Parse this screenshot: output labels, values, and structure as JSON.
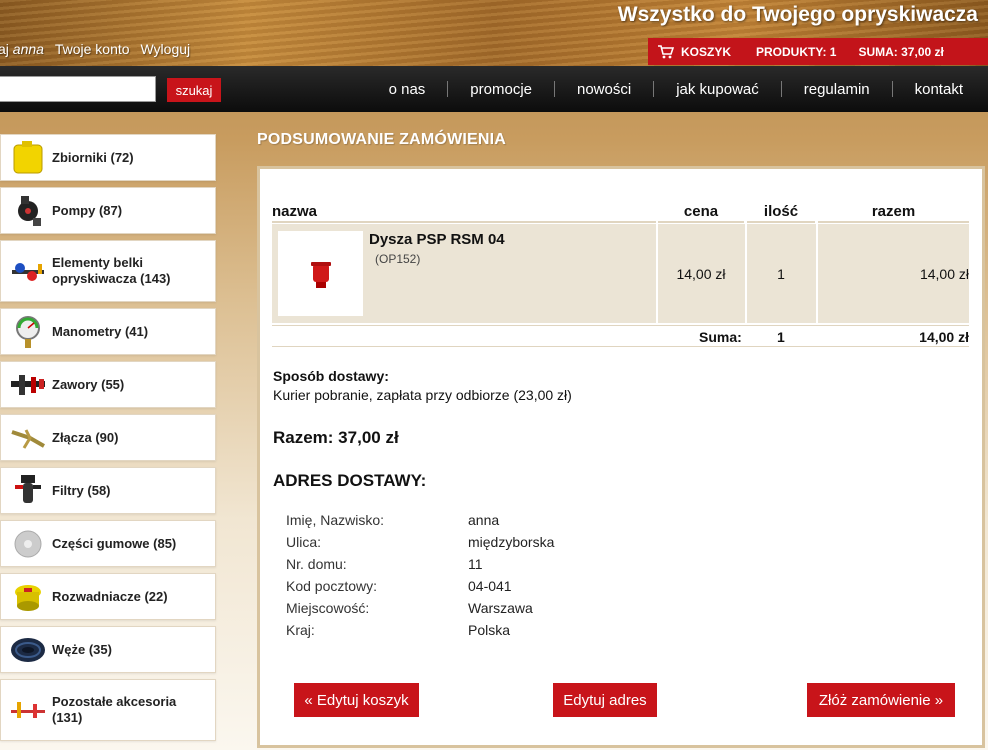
{
  "header": {
    "tagline": "Wszystko do Twojego opryskiwacza",
    "greeting": "aj",
    "username": "anna",
    "account_link": "Twoje konto",
    "logout_link": "Wyloguj",
    "cart": {
      "label": "KOSZYK",
      "products": "PRODUKTY: 1",
      "sum": "SUMA: 37,00 zł"
    }
  },
  "nav": {
    "search_placeholder": "",
    "search_button": "szukaj",
    "links": [
      "o nas",
      "promocje",
      "nowości",
      "jak kupować",
      "regulamin",
      "kontakt"
    ]
  },
  "sidebar": {
    "items": [
      {
        "label": "Zbiorniki (72)",
        "icon": "tank-icon"
      },
      {
        "label": "Pompy (87)",
        "icon": "pump-icon"
      },
      {
        "label": "Elementy belki opryskiwacza (143)",
        "icon": "boom-icon"
      },
      {
        "label": "Manometry (41)",
        "icon": "gauge-icon"
      },
      {
        "label": "Zawory (55)",
        "icon": "valve-icon"
      },
      {
        "label": "Złącza (90)",
        "icon": "connector-icon"
      },
      {
        "label": "Filtry (58)",
        "icon": "filter-icon"
      },
      {
        "label": "Części gumowe (85)",
        "icon": "rubber-icon"
      },
      {
        "label": "Rozwadniacze (22)",
        "icon": "agitator-icon"
      },
      {
        "label": "Węże (35)",
        "icon": "hose-icon"
      },
      {
        "label": "Pozostałe akcesoria (131)",
        "icon": "accessory-icon"
      }
    ]
  },
  "main": {
    "title": "PODSUMOWANIE ZAMÓWIENIA",
    "table": {
      "headers": {
        "name": "nazwa",
        "price": "cena",
        "qty": "ilość",
        "total": "razem"
      },
      "items": [
        {
          "name": "Dysza PSP RSM 04",
          "code": "(OP152)",
          "price": "14,00 zł",
          "qty": "1",
          "total": "14,00 zł"
        }
      ],
      "sum_label": "Suma:",
      "sum_qty": "1",
      "sum_total": "14,00 zł"
    },
    "shipping": {
      "title": "Sposób dostawy:",
      "value": "Kurier pobranie, zapłata przy odbiorze (23,00 zł)"
    },
    "razem": "Razem: 37,00 zł",
    "address": {
      "title": "ADRES DOSTAWY:",
      "rows": [
        {
          "k": "Imię, Nazwisko:",
          "v": "anna"
        },
        {
          "k": "Ulica:",
          "v": "międzyborska"
        },
        {
          "k": "Nr. domu:",
          "v": "11"
        },
        {
          "k": "Kod pocztowy:",
          "v": "04-041"
        },
        {
          "k": "Miejscowość:",
          "v": "Warszawa"
        },
        {
          "k": "Kraj:",
          "v": "Polska"
        }
      ]
    },
    "buttons": {
      "edit_cart": "« Edytuj koszyk",
      "edit_address": "Edytuj adres",
      "place_order": "Złóż zamówienie »"
    }
  },
  "colors": {
    "accent": "#c8141a",
    "panel_border": "#d8c39e",
    "row_bg": "#ebe4d5"
  }
}
